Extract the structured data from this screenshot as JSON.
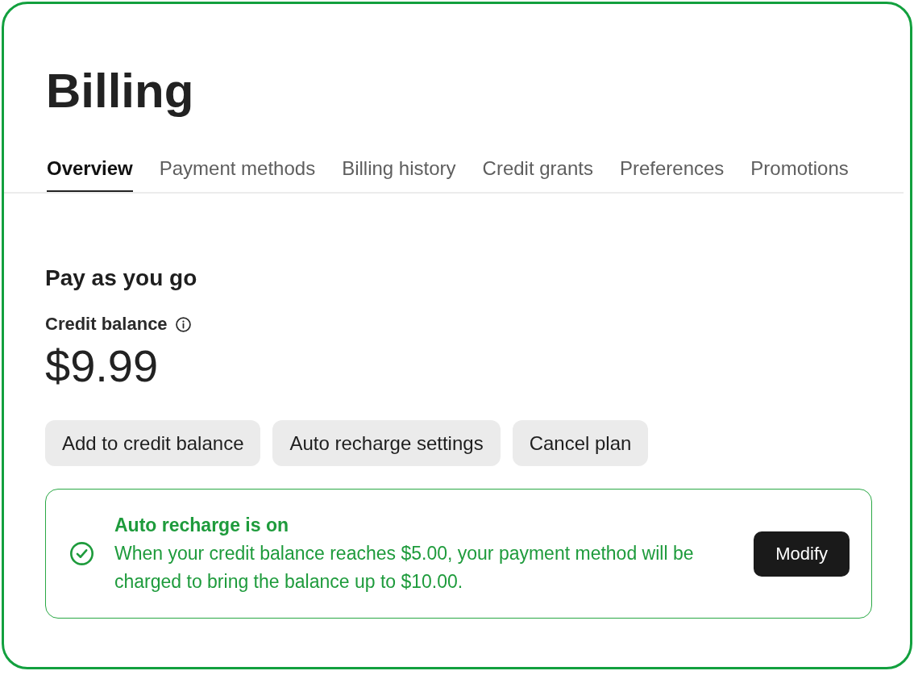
{
  "page": {
    "title": "Billing"
  },
  "tabs": [
    {
      "label": "Overview",
      "selected": true
    },
    {
      "label": "Payment methods",
      "selected": false
    },
    {
      "label": "Billing history",
      "selected": false
    },
    {
      "label": "Credit grants",
      "selected": false
    },
    {
      "label": "Preferences",
      "selected": false
    },
    {
      "label": "Promotions",
      "selected": false
    }
  ],
  "plan": {
    "heading": "Pay as you go",
    "balance_label": "Credit balance",
    "balance": "$9.99"
  },
  "actions": [
    "Add to credit balance",
    "Auto recharge settings",
    "Cancel plan"
  ],
  "notice": {
    "kind": "success",
    "title": "Auto recharge is on",
    "message": "When your credit balance reaches $5.00, your payment method will be charged to bring the balance up to $10.00.",
    "button": "Modify"
  }
}
